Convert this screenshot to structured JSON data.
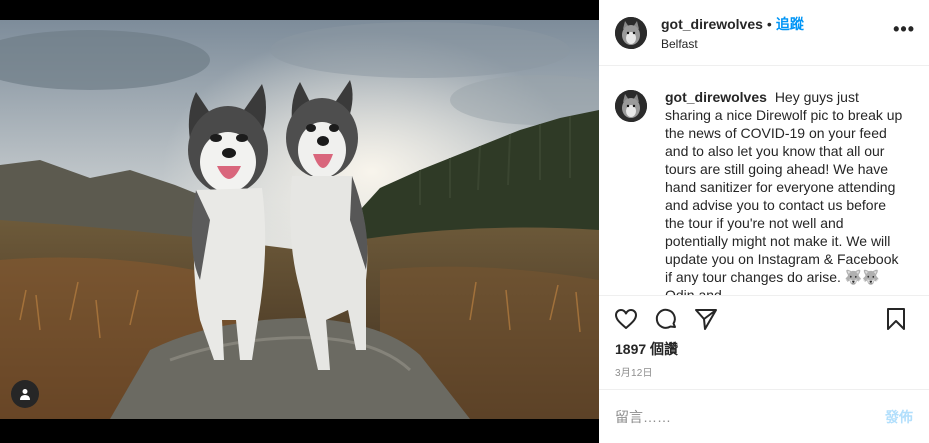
{
  "post": {
    "username": "got_direwolves",
    "separator": "•",
    "follow_label": "追蹤",
    "location": "Belfast",
    "more_icon": "more-horizontal-icon",
    "more_label": "•••"
  },
  "caption": {
    "username": "got_direwolves",
    "text": "Hey guys just sharing a nice Direwolf pic to break up the news of COVID-19 on your feed and to also let you know that all our tours are still going ahead! We have hand sanitizer for everyone attending and advise you to contact us before the tour if you're not well and potentially might not make it. We will update you on Instagram & Facebook if any tour changes do arise. 🐺🐺 Odin and"
  },
  "actions": {
    "like_icon": "heart-icon",
    "comment_icon": "comment-icon",
    "share_icon": "paper-plane-icon",
    "save_icon": "bookmark-icon"
  },
  "likes": "1897 個讚",
  "date": "3月12日",
  "comment": {
    "placeholder": "留言……",
    "post_label": "發佈"
  },
  "colors": {
    "accent": "#0095f6",
    "post_disabled": "#b2dffc",
    "muted": "#8e8e8e"
  }
}
